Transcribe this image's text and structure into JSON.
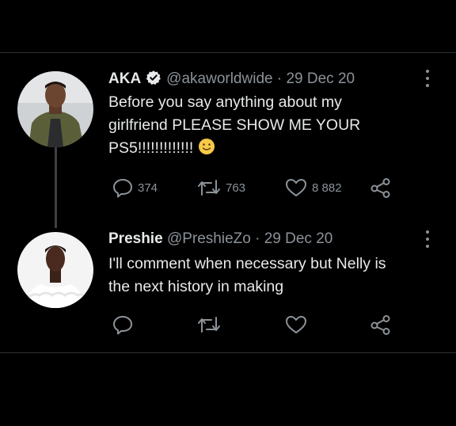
{
  "tweets": [
    {
      "display_name": "AKA",
      "handle": "@akaworldwide",
      "separator": "·",
      "date": "29 Dec 20",
      "text_lines": [
        "Before you say anything about my",
        "girlfriend PLEASE SHOW ME YOUR",
        "PS5!!!!!!!!!!!!!"
      ],
      "emoji": "smiling-face-emoji",
      "stats": {
        "replies": "374",
        "retweets": "763",
        "likes": "8 882"
      }
    },
    {
      "display_name": "Preshie",
      "handle": "@PreshieZo",
      "separator": "·",
      "date": "29 Dec 20",
      "text_lines": [
        "I'll comment when necessary  but Nelly is",
        "the next history in making"
      ],
      "stats": {
        "replies": "",
        "retweets": "",
        "likes": ""
      }
    }
  ],
  "icons": [
    "verified-badge-icon",
    "more-icon",
    "reply-icon",
    "retweet-icon",
    "like-icon",
    "share-icon"
  ],
  "colors": {
    "background": "#000000",
    "text": "#e7e9ea",
    "muted": "#8b9298",
    "verified": "#e7e9ea"
  }
}
